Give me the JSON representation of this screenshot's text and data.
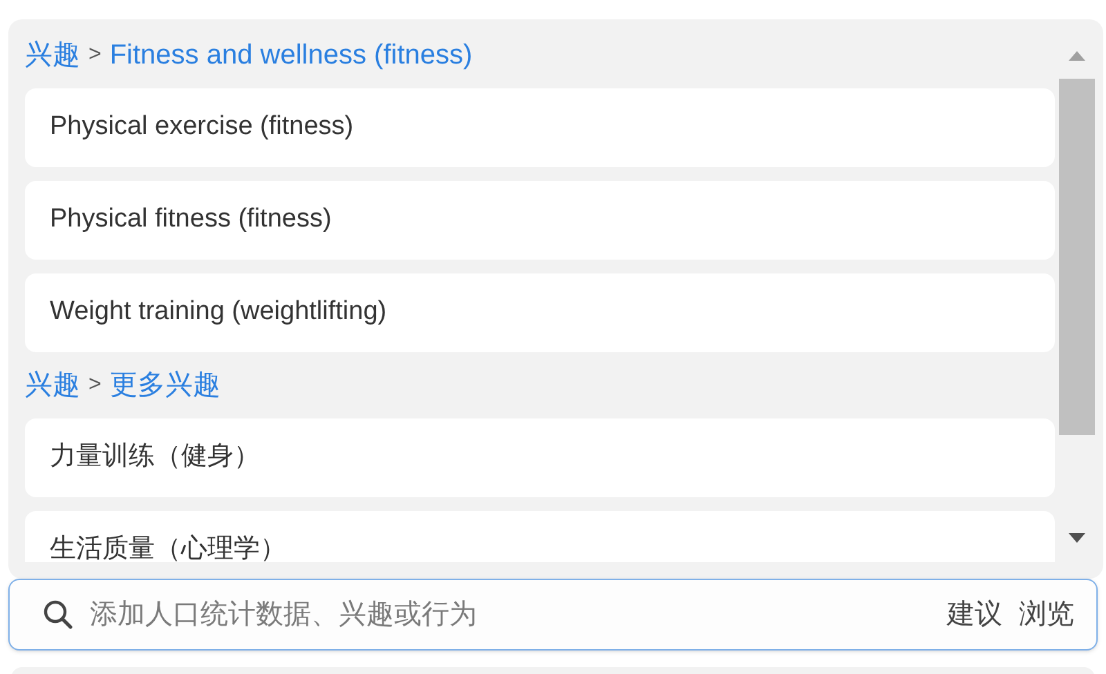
{
  "groups": [
    {
      "breadcrumb": {
        "root": "兴趣",
        "separator": ">",
        "category": "Fitness and wellness (fitness)"
      },
      "items": [
        "Physical exercise (fitness)",
        "Physical fitness (fitness)",
        "Weight training (weightlifting)"
      ]
    },
    {
      "breadcrumb": {
        "root": "兴趣",
        "separator": ">",
        "category": "更多兴趣"
      },
      "items": [
        "力量训练（健身）",
        "生活质量（心理学）"
      ]
    }
  ],
  "search": {
    "placeholder": "添加人口统计数据、兴趣或行为",
    "actions": [
      "建议",
      "浏览"
    ]
  }
}
